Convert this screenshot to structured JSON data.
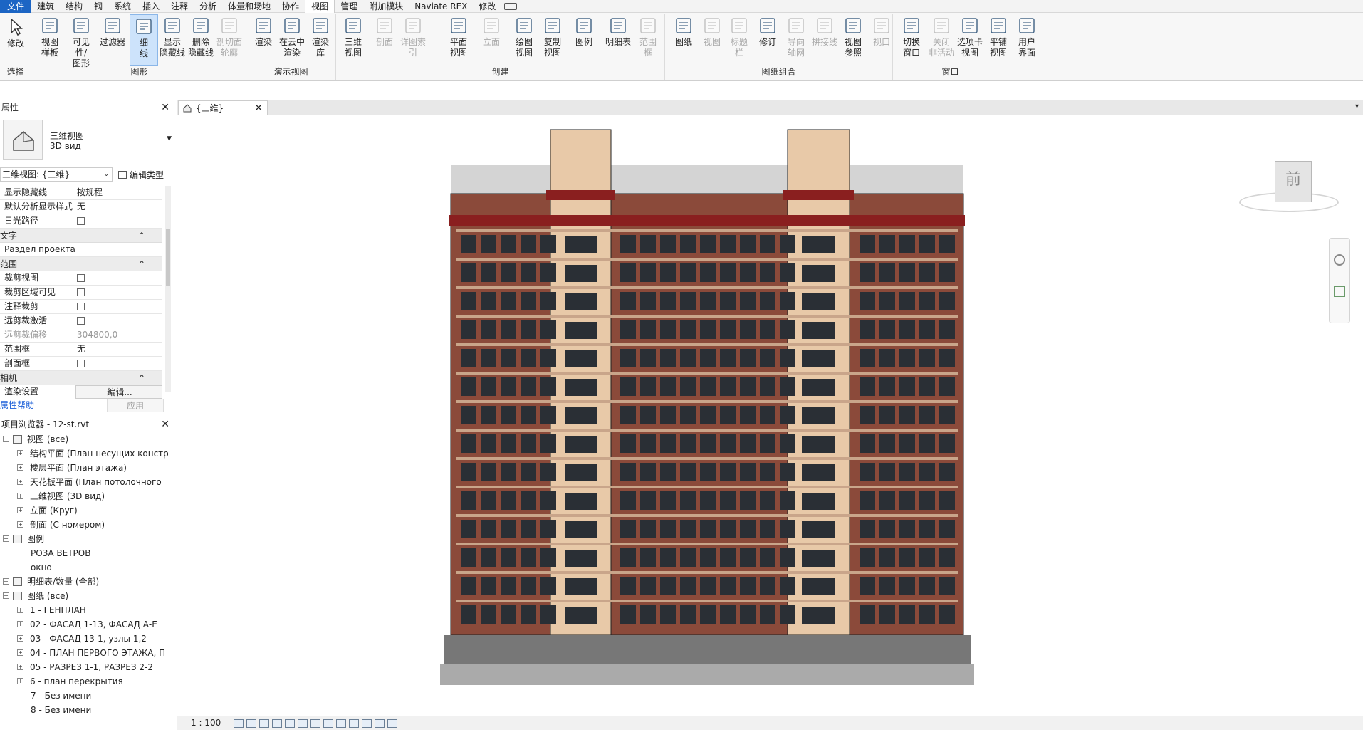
{
  "menu": {
    "items": [
      "文件",
      "建筑",
      "结构",
      "钢",
      "系统",
      "插入",
      "注释",
      "分析",
      "体量和场地",
      "协作",
      "视图",
      "管理",
      "附加模块",
      "Naviate REX",
      "修改"
    ],
    "active": "视图"
  },
  "ribbon": {
    "select_label": "选择",
    "modify_label": "修改",
    "groups": {
      "graphics": "图形",
      "presentation": "演示视图",
      "create": "创建",
      "sheet": "图纸组合",
      "window": "窗口"
    },
    "buttons": [
      {
        "label": "视图\n样板",
        "enabled": true
      },
      {
        "label": "可见性/\n图形",
        "enabled": true
      },
      {
        "label": "过滤器",
        "enabled": true
      },
      {
        "label": "细\n线",
        "enabled": true
      },
      {
        "label": "显示\n隐藏线",
        "enabled": true
      },
      {
        "label": "删除\n隐藏线",
        "enabled": true
      },
      {
        "label": "剖切面\n轮廓",
        "enabled": false
      },
      {
        "label": "渲染",
        "enabled": true
      },
      {
        "label": "在云中\n渲染",
        "enabled": true
      },
      {
        "label": "渲染\n库",
        "enabled": true
      },
      {
        "label": "三维\n视图",
        "enabled": true
      },
      {
        "label": "剖面",
        "enabled": false
      },
      {
        "label": "详图索引",
        "enabled": false
      },
      {
        "label": "平面\n视图",
        "enabled": true
      },
      {
        "label": "立面",
        "enabled": false
      },
      {
        "label": "绘图\n视图",
        "enabled": true
      },
      {
        "label": "复制\n视图",
        "enabled": true
      },
      {
        "label": "图例",
        "enabled": true
      },
      {
        "label": "明细表",
        "enabled": true
      },
      {
        "label": "范围\n框",
        "enabled": false
      },
      {
        "label": "图纸",
        "enabled": true
      },
      {
        "label": "视图",
        "enabled": false
      },
      {
        "label": "标题\n栏",
        "enabled": false
      },
      {
        "label": "修订",
        "enabled": true
      },
      {
        "label": "导向\n轴网",
        "enabled": false
      },
      {
        "label": "拼接线",
        "enabled": false
      },
      {
        "label": "视图\n参照",
        "enabled": true
      },
      {
        "label": "视口",
        "enabled": false
      },
      {
        "label": "切换\n窗口",
        "enabled": true
      },
      {
        "label": "关闭\n非活动",
        "enabled": false
      },
      {
        "label": "选项卡\n视图",
        "enabled": true
      },
      {
        "label": "平铺\n视图",
        "enabled": true
      },
      {
        "label": "用户\n界面",
        "enabled": true
      }
    ]
  },
  "properties": {
    "title": "属性",
    "type_line1": "三维视图",
    "type_line2": "3D вид",
    "view_selector": "三维视图: {三维}",
    "edit_type": "编辑类型",
    "rows": [
      {
        "kind": "row",
        "name": "显示隐藏线",
        "value": "按规程"
      },
      {
        "kind": "row",
        "name": "默认分析显示样式",
        "value": "无"
      },
      {
        "kind": "row",
        "name": "日光路径",
        "value": "",
        "checkbox": true
      },
      {
        "kind": "cat",
        "name": "文字"
      },
      {
        "kind": "row",
        "name": "Раздел проекта",
        "value": ""
      },
      {
        "kind": "cat",
        "name": "范围"
      },
      {
        "kind": "row",
        "name": "裁剪视图",
        "value": "",
        "checkbox": true
      },
      {
        "kind": "row",
        "name": "裁剪区域可见",
        "value": "",
        "checkbox": true
      },
      {
        "kind": "row",
        "name": "注释裁剪",
        "value": "",
        "checkbox": true
      },
      {
        "kind": "row",
        "name": "远剪裁激活",
        "value": "",
        "checkbox": true
      },
      {
        "kind": "row",
        "name": "远剪裁偏移",
        "value": "304800,0",
        "disabled": true
      },
      {
        "kind": "row",
        "name": "范围框",
        "value": "无"
      },
      {
        "kind": "row",
        "name": "剖面框",
        "value": "",
        "checkbox": true
      },
      {
        "kind": "cat",
        "name": "相机"
      },
      {
        "kind": "row",
        "name": "渲染设置",
        "value": "编辑..."
      }
    ],
    "help_link": "属性帮助",
    "apply_button": "应用"
  },
  "browser": {
    "title": "项目浏览器 - 12-st.rvt",
    "items": [
      {
        "level": 0,
        "label": "视图 (все)",
        "expanded": true,
        "icon": true
      },
      {
        "level": 1,
        "label": "结构平面 (План несущих констр"
      },
      {
        "level": 1,
        "label": "楼层平面 (План этажа)"
      },
      {
        "level": 1,
        "label": "天花板平面 (План потолочного"
      },
      {
        "level": 1,
        "label": "三维视图 (3D вид)"
      },
      {
        "level": 1,
        "label": "立面 (Круг)"
      },
      {
        "level": 1,
        "label": "剖面 (С номером)"
      },
      {
        "level": 0,
        "label": "图例",
        "expanded": true,
        "icon": true
      },
      {
        "level": 1,
        "label": "РОЗА ВЕТРОВ",
        "leaf": true
      },
      {
        "level": 1,
        "label": "окно",
        "leaf": true
      },
      {
        "level": 0,
        "label": "明细表/数量 (全部)",
        "expanded": false,
        "icon": true
      },
      {
        "level": 0,
        "label": "图纸 (все)",
        "expanded": true,
        "icon": true
      },
      {
        "level": 1,
        "label": "1 - ГЕНПЛАН"
      },
      {
        "level": 1,
        "label": "02 - ФАСАД 1-13, ФАСАД А-Е"
      },
      {
        "level": 1,
        "label": "03 - ФАСАД 13-1, узлы 1,2"
      },
      {
        "level": 1,
        "label": "04 - ПЛАН ПЕРВОГО ЭТАЖА, П"
      },
      {
        "level": 1,
        "label": "05 - РАЗРЕЗ 1-1, РАЗРЕЗ 2-2"
      },
      {
        "level": 1,
        "label": "6 - план перекрытия"
      },
      {
        "level": 1,
        "label": "7 - Без имени",
        "leaf": true
      },
      {
        "level": 1,
        "label": "8 - Без имени",
        "leaf": true
      }
    ]
  },
  "view": {
    "tab_label": "{三维}",
    "viewcube_face": "前",
    "scale": "1 : 100",
    "colors": {
      "brick": "#8b4a3a",
      "roof": "#8a1f1f",
      "beige": "#e8c9a8",
      "glass": "#2a2f35"
    }
  }
}
